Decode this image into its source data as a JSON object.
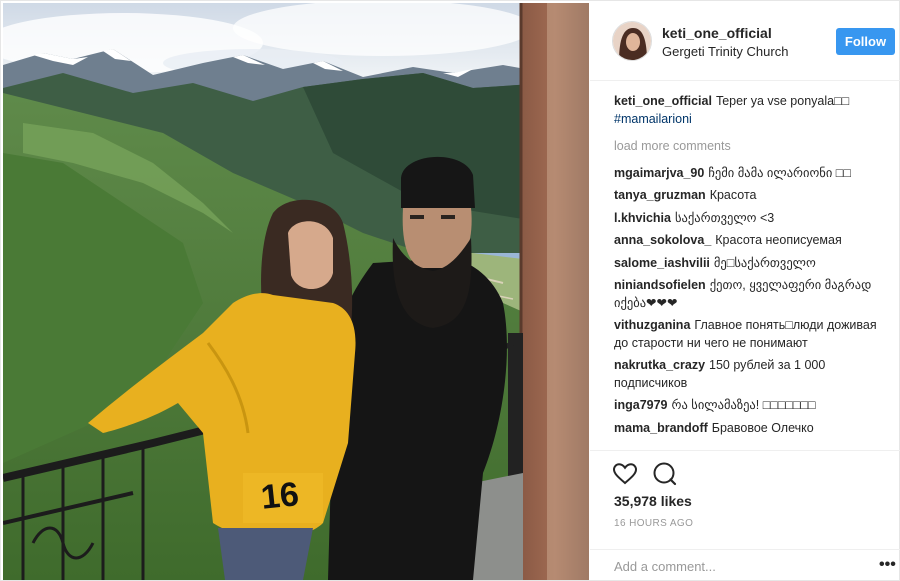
{
  "post": {
    "username": "keti_one_official",
    "location": "Gergeti Trinity Church",
    "follow_label": "Follow",
    "caption": {
      "user": "keti_one_official",
      "text": "Teper ya vse ponyala□□",
      "hashtag": "#mamailarioni"
    },
    "load_more": "load more comments",
    "comments": [
      {
        "user": "mgaimarjva_90",
        "text": "ჩემი მამა ილარიონი □□"
      },
      {
        "user": "tanya_gruzman",
        "text": "Красота"
      },
      {
        "user": "l.khvichia",
        "text": "საქართველო <3"
      },
      {
        "user": "anna_sokolova_",
        "text": "Красота неописуемая"
      },
      {
        "user": "salome_iashvilii",
        "text": "მე□საქართველო"
      },
      {
        "user": "niniandsofielen",
        "text": "ქეთო, ყველაფერი მაგრად იქება❤❤❤"
      },
      {
        "user": "vithuzganina",
        "text": "Главное понять□люди доживая до старости ни чего не понимают"
      },
      {
        "user": "nakrutka_crazy",
        "text": "150 рублей за 1 000 подписчиков"
      },
      {
        "user": "inga7979",
        "text": "რა სილამაზეა! □□□□□□□"
      },
      {
        "user": "mama_brandoff",
        "text": "Бравовое Олечко"
      }
    ],
    "likes": "35,978 likes",
    "time": "16 HOURS AGO",
    "add_comment_placeholder": "Add a comment...",
    "more_label": "•••",
    "jersey_number": "16",
    "icons": {
      "like": "heart-icon",
      "comment": "comment-bubble-icon",
      "more": "more-options-icon"
    },
    "colors": {
      "follow": "#3897f0",
      "hashtag": "#003569",
      "muted": "#999999",
      "text": "#262626"
    }
  }
}
